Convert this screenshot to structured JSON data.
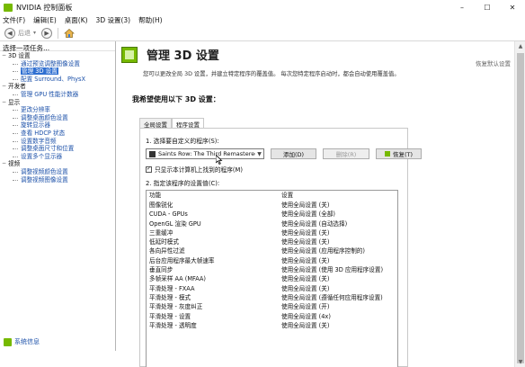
{
  "window": {
    "title": "NVIDIA 控制面板",
    "min": "–",
    "max": "☐",
    "close": "✕"
  },
  "menu": [
    "文件(F)",
    "编辑(E)",
    "桌面(K)",
    "3D 设置(3)",
    "帮助(H)"
  ],
  "toolbar": {
    "back_label": "后退",
    "dropdown_arrow": "▾"
  },
  "sidebar": {
    "task_header": "选择一项任务...",
    "tree": [
      {
        "type": "cat",
        "label": "3D 设置"
      },
      {
        "type": "leaf",
        "label": "通过预览调整图像设置"
      },
      {
        "type": "leaf",
        "label": "管理 3D 设置",
        "selected": true
      },
      {
        "type": "leaf",
        "label": "配置 Surround、PhysX"
      },
      {
        "type": "cat",
        "label": "开发者"
      },
      {
        "type": "leaf",
        "label": "管理 GPU 性能计数器"
      },
      {
        "type": "cat",
        "label": "显示"
      },
      {
        "type": "leaf",
        "label": "更改分辨率"
      },
      {
        "type": "leaf",
        "label": "调整桌面颜色设置"
      },
      {
        "type": "leaf",
        "label": "旋转显示器"
      },
      {
        "type": "leaf",
        "label": "查看 HDCP 状态"
      },
      {
        "type": "leaf",
        "label": "设置数字音频"
      },
      {
        "type": "leaf",
        "label": "调整桌面尺寸和位置"
      },
      {
        "type": "leaf",
        "label": "设置多个显示器"
      },
      {
        "type": "cat",
        "label": "视频"
      },
      {
        "type": "leaf",
        "label": "调整视频颜色设置"
      },
      {
        "type": "leaf",
        "label": "调整视频图像设置"
      }
    ],
    "system_info": "系统信息"
  },
  "main": {
    "title": "管理 3D 设置",
    "restore_defaults": "恢复默认设置",
    "description": "您可以更改全局 3D 设置，并建立特定程序的覆盖值。 每次您特定程序启动时，都会自动使用覆盖值。",
    "section_title": "我希望使用以下 3D 设置：",
    "tabs": [
      "全局设置",
      "程序设置"
    ],
    "select_program_label": "1. 选择要自定义的程序(S):",
    "selected_program": "Saints Row: The Third Remastered (s...",
    "add_button": "添加(D)",
    "remove_button": "删除(R)",
    "restore_button": "恢复(T)",
    "only_found_checkbox": "只显示本计算机上找到的程序(M)",
    "only_found_checked": true,
    "specify_label": "2. 指定该程序的设置值(C):",
    "columns": [
      "功能",
      "设置"
    ],
    "settings": [
      [
        "图像锐化",
        "使用全局设置 (关)"
      ],
      [
        "CUDA - GPUs",
        "使用全局设置 (全部)"
      ],
      [
        "OpenGL 渲染 GPU",
        "使用全局设置 (自动选择)"
      ],
      [
        "三重缓冲",
        "使用全局设置 (关)"
      ],
      [
        "低延时模式",
        "使用全局设置 (关)"
      ],
      [
        "各向异性过滤",
        "使用全局设置 (应用程序控制的)"
      ],
      [
        "后台应用程序最大帧速率",
        "使用全局设置 (关)"
      ],
      [
        "垂直同步",
        "使用全局设置 (使用 3D 应用程序设置)"
      ],
      [
        "多帧采样 AA (MFAA)",
        "使用全局设置 (关)"
      ],
      [
        "平滑处理 - FXAA",
        "使用全局设置 (关)"
      ],
      [
        "平滑处理 - 模式",
        "使用全局设置 (遵循任何应用程序设置)"
      ],
      [
        "平滑处理 - 灰度纠正",
        "使用全局设置 (开)"
      ],
      [
        "平滑处理 - 设置",
        "使用全局设置 (4x)"
      ],
      [
        "平滑处理 - 透明度",
        "使用全局设置 (关)"
      ]
    ]
  },
  "colors": {
    "accent": "#76b900",
    "selection": "#2f6fd1",
    "link": "#1a4fa8"
  }
}
